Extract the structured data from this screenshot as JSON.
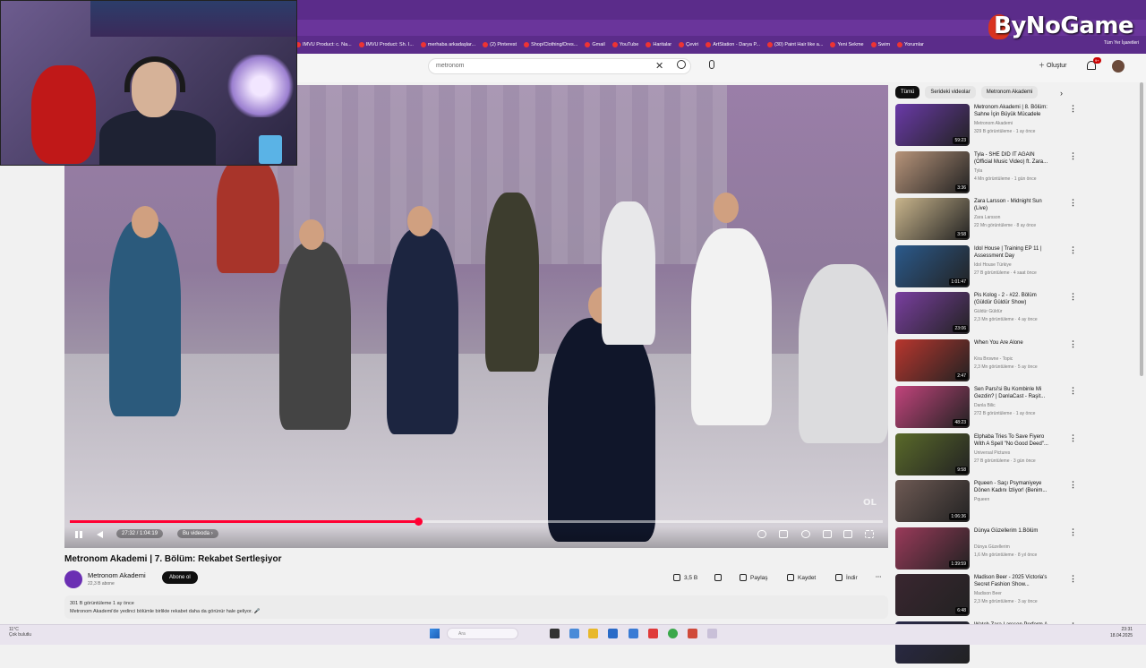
{
  "browser": {
    "bookmarks": [
      "IMVU Product: c. Na...",
      "IMVU Product: Sh. I...",
      "merhaba arkadaşlar...",
      "(2) Pinterest",
      "Shop/Clothing/Dres...",
      "Gmail",
      "YouTube",
      "Haritalar",
      "Çeviri",
      "ArtStation - Darya P...",
      "(30) Paint Hair like a...",
      "Yeni Sekme",
      "Swim",
      "Yorumlar"
    ],
    "bookmarks_right": "Tüm Yer İşaretleri"
  },
  "overlay": {
    "brand": "ByNoGame"
  },
  "header": {
    "search_value": "metronom",
    "create_label": "Oluştur",
    "notif_badge": "9+"
  },
  "player": {
    "time": "27:32 / 1:04:19",
    "chapter": "Bu videoda",
    "watermark": "OL",
    "progress": 0.428
  },
  "video": {
    "title": "Metronom Akademi | 7. Bölüm: Rekabet Sertleşiyor",
    "channel": "Metronom Akademi",
    "subs": "22,3 B abone",
    "subscribe_label": "Abone ol",
    "likes": "3,5 B",
    "share_label": "Paylaş",
    "save_label": "Kaydet",
    "download_label": "İndir",
    "views_line": "301 B görüntüleme  1 ay önce",
    "desc_line": "Metronom Akademi'de yedinci bölümle birlikte rekabet daha da görünür hale geliyor. 🎤"
  },
  "chips": [
    "Tümü",
    "Serideki videolar",
    "Metronom Akademi"
  ],
  "sidebar": [
    {
      "title": "Metronom Akademi | 8. Bölüm: Sahne İçin Büyük Mücadele",
      "channel": "Metronom Akademi",
      "meta": "329 B görüntüleme · 1 ay önce",
      "dur": "59:23",
      "color": "#6a3aa8"
    },
    {
      "title": "Tyla - SHE DID IT AGAIN (Official Music Video) ft. Zara...",
      "channel": "Tyla",
      "meta": "4 Mn görüntüleme · 1 gün önce",
      "dur": "3:36",
      "color": "#b7947a"
    },
    {
      "title": "Zara Larsson - Midnight Sun (Live)",
      "channel": "Zara Larsson",
      "meta": "22 Mn görüntüleme · 8 ay önce",
      "dur": "3:58",
      "color": "#c9b58c"
    },
    {
      "title": "Idol House | Training EP 11 | Assessment Day",
      "channel": "Idol House Türkiye",
      "meta": "27 B görüntüleme · 4 saat önce",
      "dur": "1:01:47",
      "color": "#2b5a8c"
    },
    {
      "title": "Pis Kolog - 2 - #22. Bölüm (Güldür Güldür Show)",
      "channel": "Güldür Güldür",
      "meta": "2,3 Mn görüntüleme · 4 ay önce",
      "dur": "23:06",
      "color": "#7a3fa0"
    },
    {
      "title": "When You Are Alone",
      "channel": "Kira Browne - Topic",
      "meta": "2,3 Mn görüntüleme · 5 ay önce",
      "dur": "2:47",
      "color": "#b8362e"
    },
    {
      "title": "Sen Parsi'si Bu Kombinle Mi Gezdin? | DanlaCast - Raşit...",
      "channel": "Danla Bilic",
      "meta": "272 B görüntüleme · 1 ay önce",
      "dur": "48:23",
      "color": "#c2447c"
    },
    {
      "title": "Elphaba Tries To Save Fiyero With A Spell \"No Good Deed\"...",
      "channel": "Universal Pictures",
      "meta": "27 B görüntüleme · 3 gün önce",
      "dur": "9:58",
      "color": "#5a6a2a"
    },
    {
      "title": "Pqueen - Saçı Psymaniyeye Dönen Kadını İzliyor! (Benim...",
      "channel": "Pqueen",
      "meta": "",
      "dur": "1:06:36",
      "color": "#6e5a54"
    },
    {
      "title": "Dünya Güzellerim 1.Bölüm",
      "channel": "Dünya Güzellerim",
      "meta": "1,6 Mn görüntüleme · 8 yıl önce",
      "dur": "1:39:59",
      "color": "#9a3a5a"
    },
    {
      "title": "Madison Beer - 2025 Victoria's Secret Fashion Show...",
      "channel": "Madison Beer",
      "meta": "2,3 Mn görüntüleme · 3 ay önce",
      "dur": "6:48",
      "color": "#3a2630"
    },
    {
      "title": "Watch Zara Larsson Perform A",
      "channel": "",
      "meta": "",
      "dur": "",
      "color": "#2a2a4a"
    }
  ],
  "taskbar": {
    "weather": "11°C",
    "weather_desc": "Çok bulutlu",
    "search": "Ara",
    "time": "23:31",
    "date": "18.04.2025"
  }
}
